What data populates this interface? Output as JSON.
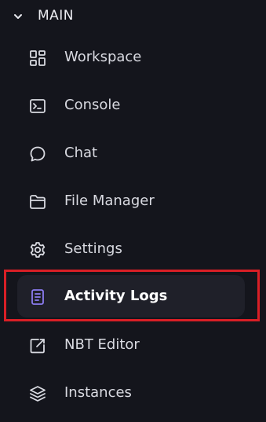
{
  "section": {
    "title": "MAIN",
    "chevron_icon": "chevron-down-icon"
  },
  "nav": {
    "items": [
      {
        "label": "Workspace",
        "icon": "dashboard-grid-icon",
        "active": false
      },
      {
        "label": "Console",
        "icon": "terminal-icon",
        "active": false
      },
      {
        "label": "Chat",
        "icon": "chat-bubble-icon",
        "active": false
      },
      {
        "label": "File Manager",
        "icon": "folder-icon",
        "active": false
      },
      {
        "label": "Settings",
        "icon": "gear-icon",
        "active": false
      },
      {
        "label": "Activity Logs",
        "icon": "document-lines-icon",
        "active": true
      },
      {
        "label": "NBT Editor",
        "icon": "edit-square-icon",
        "active": false
      },
      {
        "label": "Instances",
        "icon": "layers-icon",
        "active": false
      }
    ]
  },
  "colors": {
    "background": "#14151c",
    "active_background": "#1f2029",
    "active_icon": "#8b7bf0",
    "highlight_border": "#d91f26"
  }
}
